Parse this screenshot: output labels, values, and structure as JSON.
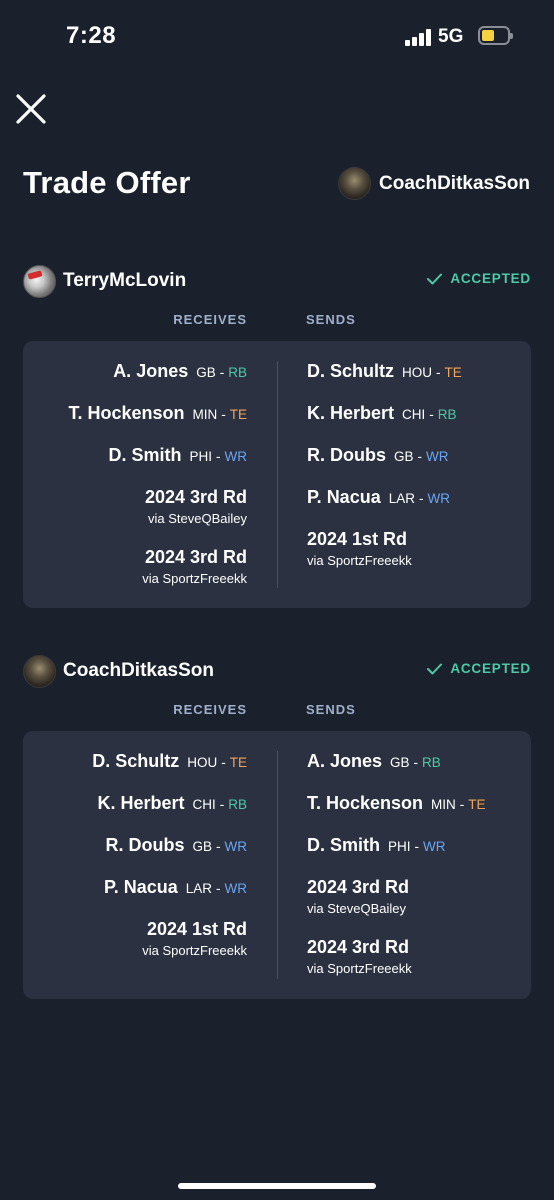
{
  "status_bar": {
    "time": "7:28",
    "network": "5G"
  },
  "header": {
    "title": "Trade Offer",
    "partner_name": "CoachDitkasSon"
  },
  "labels": {
    "receives": "RECEIVES",
    "sends": "SENDS"
  },
  "colors": {
    "background": "#1b212c",
    "card": "#2b3140",
    "accepted": "#4dc9a6",
    "RB": "#4dc9a6",
    "TE": "#f2a45a",
    "WR": "#6aa6f3"
  },
  "sections": [
    {
      "team": "TerryMcLovin",
      "status": "ACCEPTED",
      "receives": [
        {
          "kind": "player",
          "name": "A. Jones",
          "team": "GB",
          "pos": "RB"
        },
        {
          "kind": "player",
          "name": "T. Hockenson",
          "team": "MIN",
          "pos": "TE"
        },
        {
          "kind": "player",
          "name": "D. Smith",
          "team": "PHI",
          "pos": "WR"
        },
        {
          "kind": "pick",
          "name": "2024 3rd Rd",
          "via": "via SteveQBailey"
        },
        {
          "kind": "pick",
          "name": "2024 3rd Rd",
          "via": "via SportzFreeekk"
        }
      ],
      "sends": [
        {
          "kind": "player",
          "name": "D. Schultz",
          "team": "HOU",
          "pos": "TE"
        },
        {
          "kind": "player",
          "name": "K. Herbert",
          "team": "CHI",
          "pos": "RB"
        },
        {
          "kind": "player",
          "name": "R. Doubs",
          "team": "GB",
          "pos": "WR"
        },
        {
          "kind": "player",
          "name": "P. Nacua",
          "team": "LAR",
          "pos": "WR"
        },
        {
          "kind": "pick",
          "name": "2024 1st Rd",
          "via": "via SportzFreeekk"
        }
      ]
    },
    {
      "team": "CoachDitkasSon",
      "status": "ACCEPTED",
      "receives": [
        {
          "kind": "player",
          "name": "D. Schultz",
          "team": "HOU",
          "pos": "TE"
        },
        {
          "kind": "player",
          "name": "K. Herbert",
          "team": "CHI",
          "pos": "RB"
        },
        {
          "kind": "player",
          "name": "R. Doubs",
          "team": "GB",
          "pos": "WR"
        },
        {
          "kind": "player",
          "name": "P. Nacua",
          "team": "LAR",
          "pos": "WR"
        },
        {
          "kind": "pick",
          "name": "2024 1st Rd",
          "via": "via SportzFreeekk"
        }
      ],
      "sends": [
        {
          "kind": "player",
          "name": "A. Jones",
          "team": "GB",
          "pos": "RB"
        },
        {
          "kind": "player",
          "name": "T. Hockenson",
          "team": "MIN",
          "pos": "TE"
        },
        {
          "kind": "player",
          "name": "D. Smith",
          "team": "PHI",
          "pos": "WR"
        },
        {
          "kind": "pick",
          "name": "2024 3rd Rd",
          "via": "via SteveQBailey"
        },
        {
          "kind": "pick",
          "name": "2024 3rd Rd",
          "via": "via SportzFreeekk"
        }
      ]
    }
  ]
}
